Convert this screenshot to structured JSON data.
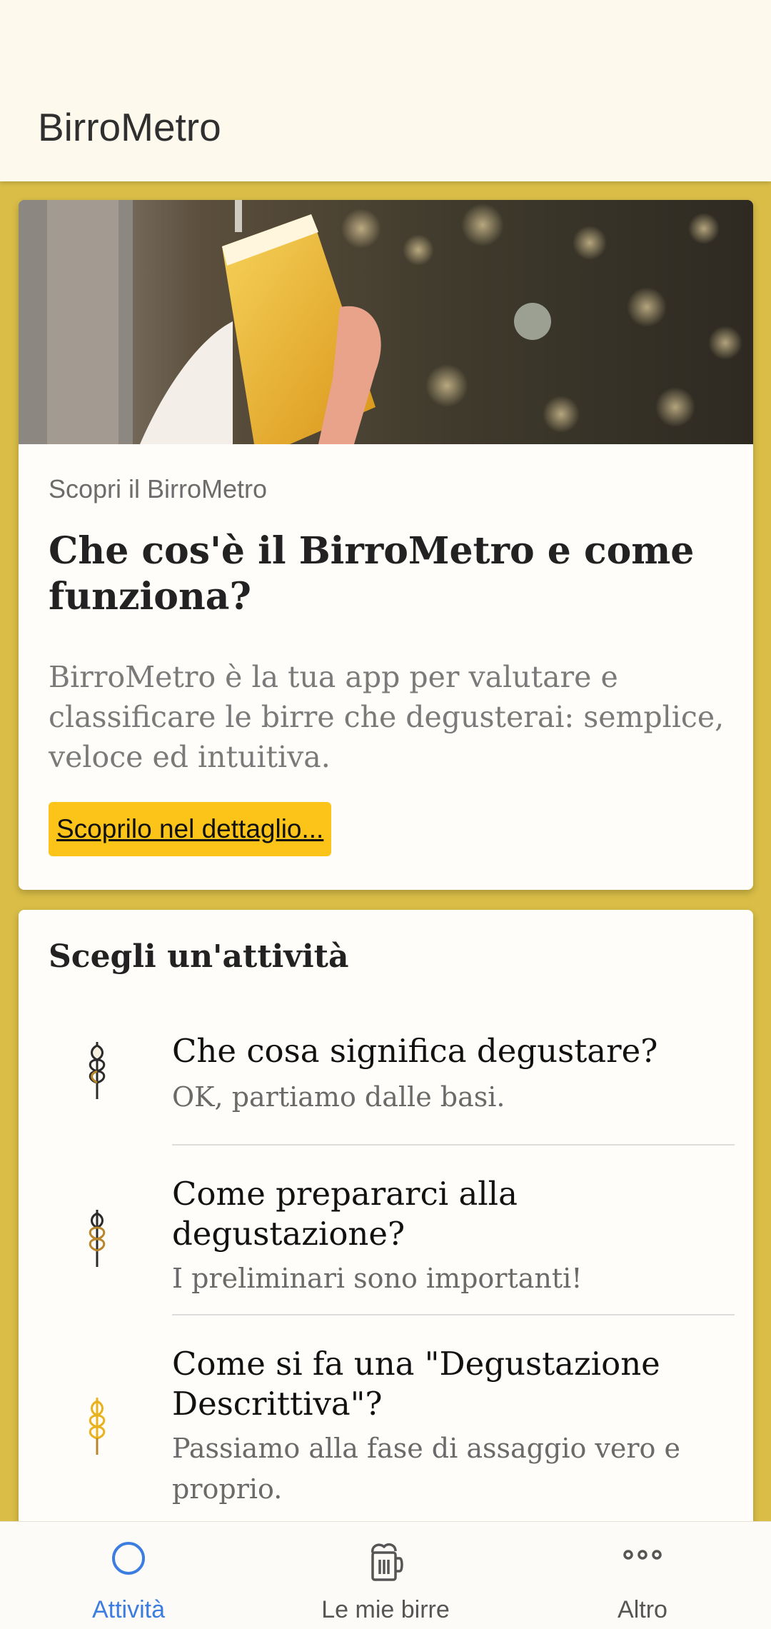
{
  "app": {
    "title": "BirroMetro"
  },
  "hero": {
    "eyebrow": "Scopri il BirroMetro",
    "headline": "Che cos'è il BirroMetro e come funziona?",
    "description": "BirroMetro è la tua app per valutare e classificare le birre che degusterai: semplice, veloce ed intuitiva.",
    "cta": "Scoprilo nel dettaglio..."
  },
  "activities": {
    "title": "Scegli un'attività",
    "items": [
      {
        "title": "Che cosa significa degustare?",
        "subtitle": "OK, partiamo dalle basi.",
        "icon": "wheat-icon",
        "color": "#2b2b2b"
      },
      {
        "title": "Come prepararci alla degustazione?",
        "subtitle": "I preliminari sono importanti!",
        "icon": "wheat-icon",
        "color": "#b8862a"
      },
      {
        "title": "Come si fa una \"Degustazione Descrittiva\"?",
        "subtitle": "Passiamo alla fase di assaggio vero e proprio.",
        "icon": "wheat-icon",
        "color": "#e8b21f"
      }
    ]
  },
  "nav": {
    "items": [
      {
        "label": "Attività",
        "icon": "circle-icon",
        "active": true
      },
      {
        "label": "Le mie birre",
        "icon": "beer-mug-icon",
        "active": false
      },
      {
        "label": "Altro",
        "icon": "more-dots-icon",
        "active": false
      }
    ]
  },
  "colors": {
    "background": "#d9bd47",
    "accent": "#fcc419",
    "active_nav": "#3b7de0"
  }
}
